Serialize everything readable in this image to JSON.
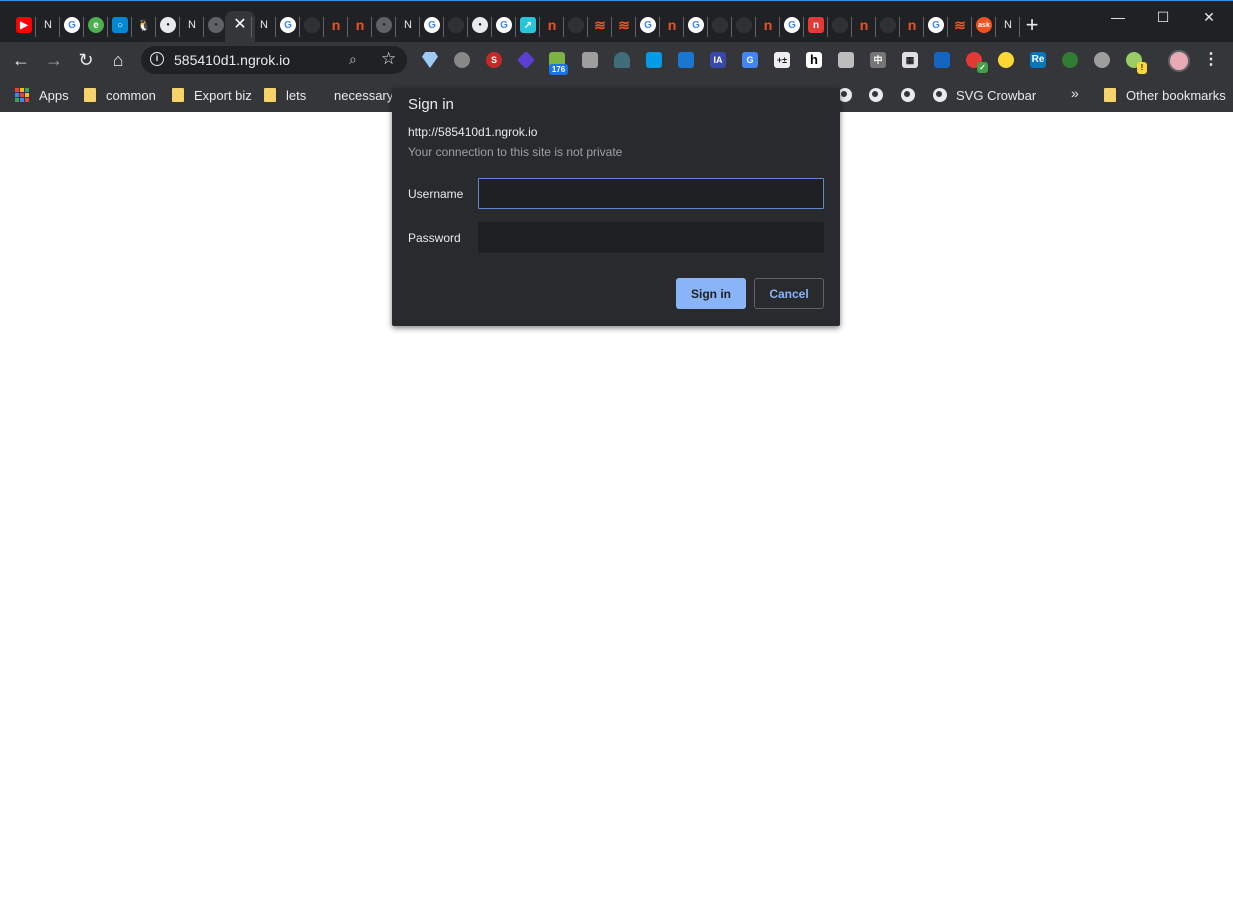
{
  "tabs": {
    "icons": [
      "youtube-icon",
      "notion-icon",
      "google-icon",
      "green-circle-icon",
      "blue-square-icon",
      "tux-icon",
      "globe-icon",
      "notion-icon",
      "globe-grey-icon",
      "close-icon",
      "notion-icon",
      "google-icon",
      "github-icon",
      "n-red-icon",
      "n-red-icon",
      "globe-grey-icon",
      "notion-icon",
      "google-icon",
      "github-icon",
      "globe-icon",
      "google-icon",
      "teal-square-icon",
      "n-red-icon",
      "github-icon",
      "stackoverflow-icon",
      "stackoverflow-icon",
      "google-icon",
      "n-red-icon",
      "google-icon",
      "github-icon",
      "github-icon",
      "n-red-icon",
      "google-icon",
      "n-red-box-icon",
      "github-icon",
      "n-red-icon",
      "github-icon",
      "n-red-icon",
      "google-icon",
      "stackoverflow-icon",
      "ask-icon",
      "notion-icon"
    ],
    "new_tab_label": "+"
  },
  "window_controls": {
    "minimize": "—",
    "maximize": "☐",
    "close": "✕"
  },
  "toolbar": {
    "back": "←",
    "forward": "→",
    "reload": "↻",
    "home": "⌂",
    "url": "585410d1.ngrok.io",
    "info_glyph": "i",
    "zoom_glyph": "⌕",
    "star_glyph": "☆",
    "extension_badge": "176",
    "menu_glyph": "⋮"
  },
  "bookmarks": {
    "apps": "Apps",
    "items": [
      "common",
      "Export biz",
      "lets",
      "necessary"
    ],
    "svg_crowbar": "SVG Crowbar",
    "more": "»",
    "other": "Other bookmarks"
  },
  "dialog": {
    "title": "Sign in",
    "origin": "http://585410d1.ngrok.io",
    "warning": "Your connection to this site is not private",
    "username_label": "Username",
    "username_value": "",
    "password_label": "Password",
    "password_value": "",
    "signin_label": "Sign in",
    "cancel_label": "Cancel"
  },
  "colors": {
    "frame": "#202124",
    "toolbar": "#35363a",
    "dialog_bg": "#292a2d",
    "accent": "#8ab4f8",
    "focus_border": "#5d88c9"
  }
}
